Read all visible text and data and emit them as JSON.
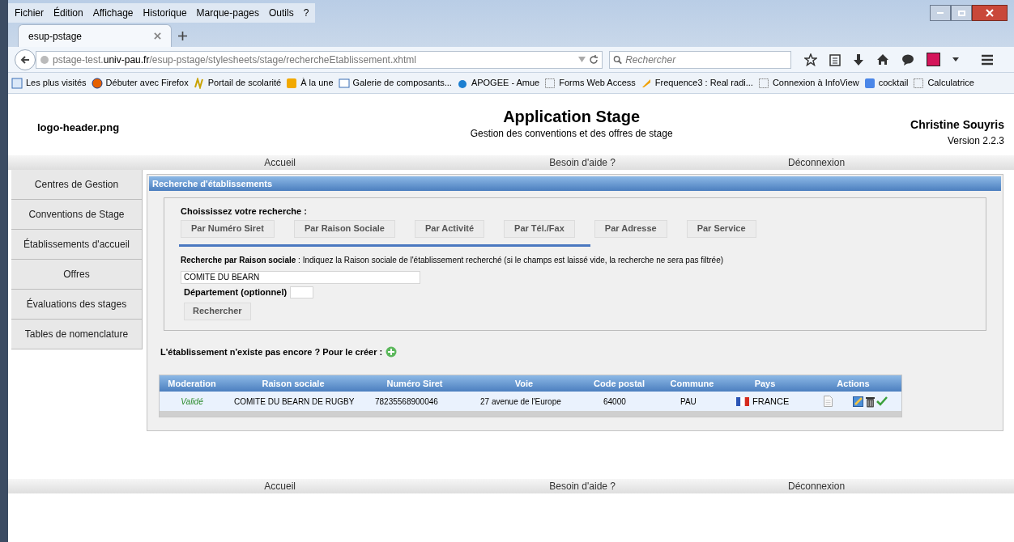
{
  "menu_bar": [
    "Fichier",
    "Édition",
    "Affichage",
    "Historique",
    "Marque-pages",
    "Outils",
    "?"
  ],
  "browser_tab": {
    "title": "esup-pstage"
  },
  "address_bar": {
    "host_prefix": "pstage-test.",
    "host": "univ-pau.fr",
    "path": "/esup-pstage/stylesheets/stage/rechercheEtablissement.xhtml"
  },
  "search_box": {
    "placeholder": "Rechercher"
  },
  "bookmarks": [
    {
      "label": "Les plus visités",
      "kind": "page"
    },
    {
      "label": "Débuter avec Firefox",
      "kind": "firefox"
    },
    {
      "label": "Portail de scolarité",
      "kind": "portal"
    },
    {
      "label": "À la une",
      "kind": "rss"
    },
    {
      "label": "Galerie de composants...",
      "kind": "gallery"
    },
    {
      "label": "APOGEE - Amue",
      "kind": "apogee"
    },
    {
      "label": "Forms Web Access",
      "kind": "blank"
    },
    {
      "label": "Frequence3 : Real radi...",
      "kind": "radio"
    },
    {
      "label": "Connexion à InfoView",
      "kind": "blank"
    },
    {
      "label": "cocktail",
      "kind": "google"
    },
    {
      "label": "Calculatrice",
      "kind": "blank"
    }
  ],
  "header": {
    "logo_alt": "logo-header.png",
    "title": "Application Stage",
    "subtitle": "Gestion des conventions et des offres de stage",
    "user": "Christine Souyris",
    "version": "Version 2.2.3"
  },
  "top_nav": [
    "Accueil",
    "Besoin d'aide ?",
    "Déconnexion"
  ],
  "sidebar": [
    "Centres de Gestion",
    "Conventions de Stage",
    "Établissements d'accueil",
    "Offres",
    "Évaluations des stages",
    "Tables de nomenclature"
  ],
  "panel": {
    "title": "Recherche d'établissements",
    "choose_label": "Choississez votre recherche :",
    "search_types": [
      "Par Numéro Siret",
      "Par Raison Sociale",
      "Par Activité",
      "Par Tél./Fax",
      "Par Adresse",
      "Par Service"
    ],
    "instruction": "**Recherche par Raison sociale** : Indiquez la Raison sociale de l'établissement recherché (si le champs est laissé vide, la recherche ne sera pas filtrée)",
    "name_value": "COMITE DU BEARN",
    "department_label": "Département (optionnel)",
    "search_button": "Rechercher",
    "create_text": "L'établissement n'existe pas encore ? Pour le créer :"
  },
  "table": {
    "columns": [
      "Moderation",
      "Raison sociale",
      "Numéro Siret",
      "Voie",
      "Code postal",
      "Commune",
      "Pays",
      "Actions"
    ],
    "rows": [
      {
        "moderation": "Validé",
        "raison_sociale": "COMITE DU BEARN DE RUGBY",
        "siret": "78235568900046",
        "voie": "27 avenue de l'Europe",
        "code_postal": "64000",
        "commune": "PAU",
        "pays": "FRANCE"
      }
    ]
  },
  "footer_nav": [
    "Accueil",
    "Besoin d'aide ?",
    "Déconnexion"
  ]
}
